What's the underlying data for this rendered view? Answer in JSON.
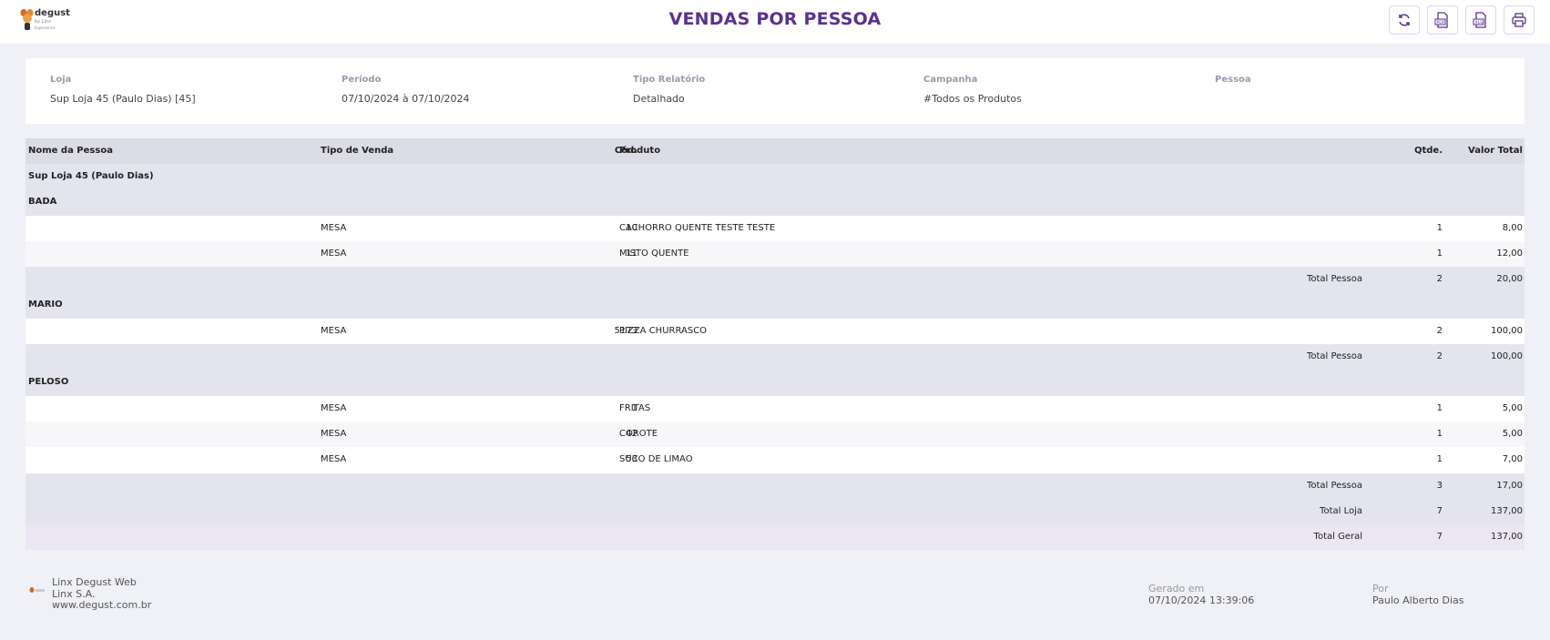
{
  "app": {
    "logo_text": "degust",
    "logo_sub": "by Linx",
    "logo_tag": "Experience"
  },
  "header": {
    "title": "VENDAS POR PESSOA",
    "actions": [
      {
        "name": "refresh-icon"
      },
      {
        "name": "pdf-export-icon",
        "label": "PDF"
      },
      {
        "name": "xls-export-icon",
        "label": "XLS"
      },
      {
        "name": "print-icon"
      }
    ]
  },
  "filters": {
    "loja": {
      "label": "Loja",
      "value": "Sup Loja 45 (Paulo Dias) [45]"
    },
    "periodo": {
      "label": "Período",
      "value": "07/10/2024 à 07/10/2024"
    },
    "tipo": {
      "label": "Tipo Relatório",
      "value": "Detalhado"
    },
    "campanha": {
      "label": "Campanha",
      "value": "#Todos os Produtos"
    },
    "pessoa": {
      "label": "Pessoa",
      "value": ""
    }
  },
  "table": {
    "columns": {
      "nome": "Nome da Pessoa",
      "tipo": "Tipo de Venda",
      "cod": "Cód.",
      "produto": "Produto",
      "qtde": "Qtde.",
      "valor": "Valor Total"
    },
    "store": "Sup Loja 45 (Paulo Dias)",
    "people": [
      {
        "name": "BADA",
        "items": [
          {
            "tipo": "MESA",
            "cod": "10",
            "produto": "CACHORRO QUENTE TESTE TESTE",
            "qtde": "1",
            "valor": "8,00"
          },
          {
            "tipo": "MESA",
            "cod": "11",
            "produto": "MISTO QUENTE",
            "qtde": "1",
            "valor": "12,00"
          }
        ],
        "total_label": "Total Pessoa",
        "total_qtde": "2",
        "total_valor": "20,00"
      },
      {
        "name": "MARIO",
        "items": [
          {
            "tipo": "MESA",
            "cod": "5173",
            "produto": "PIZZA CHURRASCO",
            "qtde": "2",
            "valor": "100,00"
          }
        ],
        "total_label": "Total Pessoa",
        "total_qtde": "2",
        "total_valor": "100,00"
      },
      {
        "name": "PELOSO",
        "items": [
          {
            "tipo": "MESA",
            "cod": "1",
            "produto": "FRITAS",
            "qtde": "1",
            "valor": "5,00"
          },
          {
            "tipo": "MESA",
            "cod": "42",
            "produto": "COROTE",
            "qtde": "1",
            "valor": "5,00"
          },
          {
            "tipo": "MESA",
            "cod": "53",
            "produto": "SUCO DE LIMAO",
            "qtde": "1",
            "valor": "7,00"
          }
        ],
        "total_label": "Total Pessoa",
        "total_qtde": "3",
        "total_valor": "17,00"
      }
    ],
    "total_loja": {
      "label": "Total Loja",
      "qtde": "7",
      "valor": "137,00"
    },
    "total_geral": {
      "label": "Total Geral",
      "qtde": "7",
      "valor": "137,00"
    }
  },
  "footer": {
    "company": [
      "Linx Degust Web",
      "Linx S.A.",
      "www.degust.com.br"
    ],
    "generated_label": "Gerado em",
    "generated_value": "07/10/2024 13:39:06",
    "by_label": "Por",
    "by_value": "Paulo Alberto Dias"
  },
  "colors": {
    "accent": "#5a3190",
    "header_row": "#dbdce6",
    "group_row": "#e3e4ed",
    "grand_total_row": "#ebe6f3",
    "background": "#f0f1f6"
  }
}
